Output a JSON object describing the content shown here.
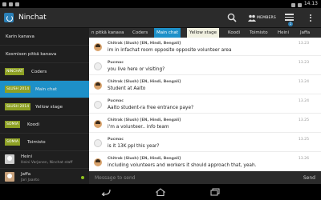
{
  "status": {
    "time": "14.13"
  },
  "app": {
    "title": "Ninchat",
    "members_label": "MEMBERS",
    "menu_badge": "1",
    "accent": "#1e90c8"
  },
  "sidebar": {
    "items": [
      {
        "label": "Karin kanava"
      },
      {
        "label": "Kosmisen pitkä kanava"
      },
      {
        "tag": "NINCHAT",
        "label": "Coders",
        "tag_color": "#8da024"
      },
      {
        "tag": "SLUSH 2014",
        "label": "Main chat",
        "tag_color": "#8da024",
        "active": true
      },
      {
        "tag": "SLUSH 2014",
        "label": "Yellow stage",
        "tag_color": "#8da024"
      },
      {
        "tag": "SOMIA",
        "label": "Koodi",
        "tag_color": "#8da024"
      },
      {
        "tag": "SOMIA",
        "label": "Toimisto",
        "tag_color": "#8da024"
      }
    ],
    "people": [
      {
        "name": "Heini",
        "sub": "Heini Varjonen, Ninchat staff"
      },
      {
        "name": "Jaffa",
        "sub": "Jari Jaanto",
        "online": true
      }
    ]
  },
  "tabs": [
    {
      "label": "n pitkä kanava"
    },
    {
      "label": "Coders"
    },
    {
      "label": "Main chat",
      "active": true
    },
    {
      "label": "Yellow stage",
      "yellow": true
    },
    {
      "label": "Koodi"
    },
    {
      "label": "Toimisto"
    },
    {
      "label": "Heini"
    },
    {
      "label": "Jaffa"
    }
  ],
  "messages": [
    {
      "sender": "Chitrak (Slush) [EN, Hindi, Bengali]",
      "text": "im in infachat room opposite opposite volunteer area",
      "time": "13.23",
      "avatar": "chitrak"
    },
    {
      "sender": "Pucmac",
      "text": "you live here or visiting?",
      "time": "13.23",
      "avatar": "pucmac"
    },
    {
      "sender": "Chitrak (Slush) [EN, Hindi, Bengali]",
      "text": "Student at Aalto",
      "time": "13.24",
      "avatar": "chitrak"
    },
    {
      "sender": "Pucmac",
      "text": "Aalto student-ra free entrance paye?",
      "time": "13.24",
      "avatar": "pucmac"
    },
    {
      "sender": "Chitrak (Slush) [EN, Hindi, Bengali]",
      "text": "i'm a volunteer.. info team",
      "time": "13.25",
      "avatar": "chitrak"
    },
    {
      "sender": "Pucmac",
      "text": "is it 13K ppl this year?",
      "time": "13.25",
      "avatar": "pucmac"
    },
    {
      "sender": "Chitrak (Slush) [EN, Hindi, Bengali]",
      "text": "including volunteers and workers it should approach that, yeah.",
      "time": "13.26",
      "avatar": "chitrak"
    }
  ],
  "composer": {
    "placeholder": "Message to send",
    "send_label": "Send"
  }
}
